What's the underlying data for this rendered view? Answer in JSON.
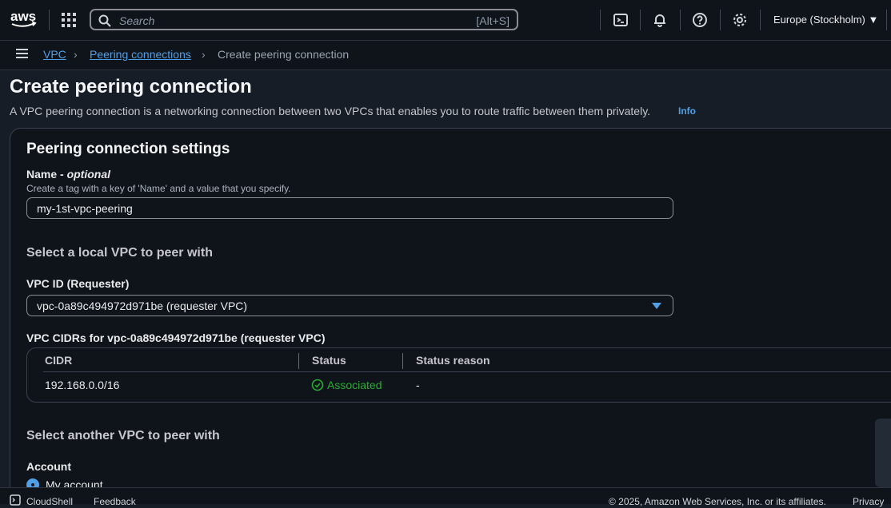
{
  "topbar": {
    "logo": "aws",
    "search_placeholder": "Search",
    "search_shortcut": "[Alt+S]",
    "region": "Europe (Stockholm) ▼",
    "icons": [
      "services-grid-icon",
      "cloudshell-icon",
      "bell-icon",
      "help-icon",
      "settings-icon"
    ]
  },
  "breadcrumb": {
    "items": [
      "VPC",
      "Peering connections",
      "Create peering connection"
    ]
  },
  "page": {
    "title": "Create peering connection",
    "description": "A VPC peering connection is a networking connection between two VPCs that enables you to route traffic between them privately.",
    "info_link": "Info"
  },
  "settings": {
    "heading": "Peering connection settings",
    "name_label": "Name - ",
    "name_optional": "optional",
    "name_hint": "Create a tag with a key of 'Name' and a value that you specify.",
    "name_value": "my-1st-vpc-peering",
    "local_heading": "Select a local VPC to peer with",
    "vpc_id_label": "VPC ID (Requester)",
    "vpc_id_value": "vpc-0a89c494972d971be (requester VPC)",
    "cidrs_label": "VPC CIDRs for vpc-0a89c494972d971be (requester VPC)",
    "table": {
      "columns": [
        "CIDR",
        "Status",
        "Status reason"
      ],
      "rows": [
        {
          "cidr": "192.168.0.0/16",
          "status": "Associated",
          "reason": "-"
        }
      ]
    },
    "another_heading": "Select another VPC to peer with",
    "account_label": "Account",
    "account_option": "My account"
  },
  "footer": {
    "cloudshell": "CloudShell",
    "feedback": "Feedback",
    "copyright": "© 2025, Amazon Web Services, Inc. or its affiliates.",
    "privacy": "Privacy"
  },
  "colors": {
    "accent": "#539fe5",
    "success": "#29ad32",
    "background": "#161d26"
  }
}
